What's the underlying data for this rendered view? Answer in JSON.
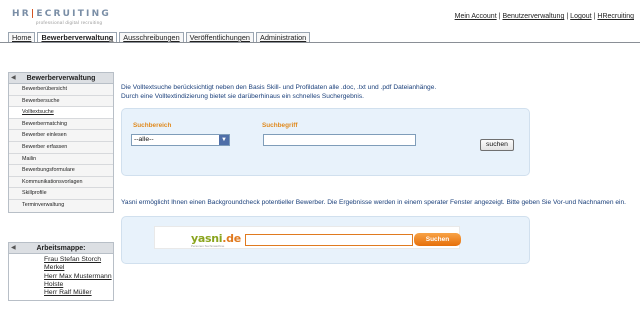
{
  "logo": {
    "name": "HR|ECRUITING",
    "pre": "HR",
    "bar": "|",
    "post": "ECRUITING",
    "tagline": "professional digital recruiting"
  },
  "top_links": [
    "Mein Account",
    "Benutzerverwaltung",
    "Logout",
    "HRecruiting"
  ],
  "tabs": [
    {
      "label": "Home",
      "active": false
    },
    {
      "label": "Bewerberverwaltung",
      "active": true
    },
    {
      "label": "Ausschreibungen",
      "active": false
    },
    {
      "label": "Veröffentlichungen",
      "active": false
    },
    {
      "label": "Administration",
      "active": false
    }
  ],
  "sidebar": {
    "title": "Bewerberverwaltung",
    "items": [
      "Bewerberübersicht",
      "Bewerbersuche",
      "Volltextsuche",
      "Bewerbermatching",
      "Bewerber einlesen",
      "Bewerber erfassen",
      "Mailin",
      "Bewerbungsformulare",
      "Kommunikationsvorlagen",
      "Skillprofile",
      "Terminverwaltung"
    ],
    "active_index": 2
  },
  "workfolder": {
    "title": "Arbeitsmappe:",
    "items": [
      "Frau Stefan Storch",
      "Merkel",
      "Herr Max Mustermann",
      "Holste",
      "Herr Ralf Müller"
    ]
  },
  "main": {
    "intro_line1": "Die Volltextsuche berücksichtigt neben den Basis Skill- und Profildaten alle .doc, .txt und .pdf Dateianhänge.",
    "intro_line2": "Durch eine Volltextindizierung bietet sie darüberhinaus ein schnelles Suchergebnis.",
    "search": {
      "area_label": "Suchbereich",
      "term_label": "Suchbegriff",
      "area_value": "--alle--",
      "term_value": "",
      "button_label": "suchen"
    },
    "yasni_text": "Yasni ermöglicht Ihnen einen Backgroundcheck potentieller Bewerber. Die Ergebnisse werden in einem sperater Fenster angezeigt. Bitte geben Sie Vor-und Nachnamen ein.",
    "yasni": {
      "logo_main": "yasni",
      "logo_tld": ".de",
      "tagline": "Personen Suchmaschine",
      "input_value": "",
      "button_label": "Suchen"
    }
  },
  "colors": {
    "accent_orange": "#e07a1f",
    "panel_bg": "#e8f2fb",
    "text_blue": "#1a3f7a",
    "yasni_green": "#8aa41d"
  }
}
